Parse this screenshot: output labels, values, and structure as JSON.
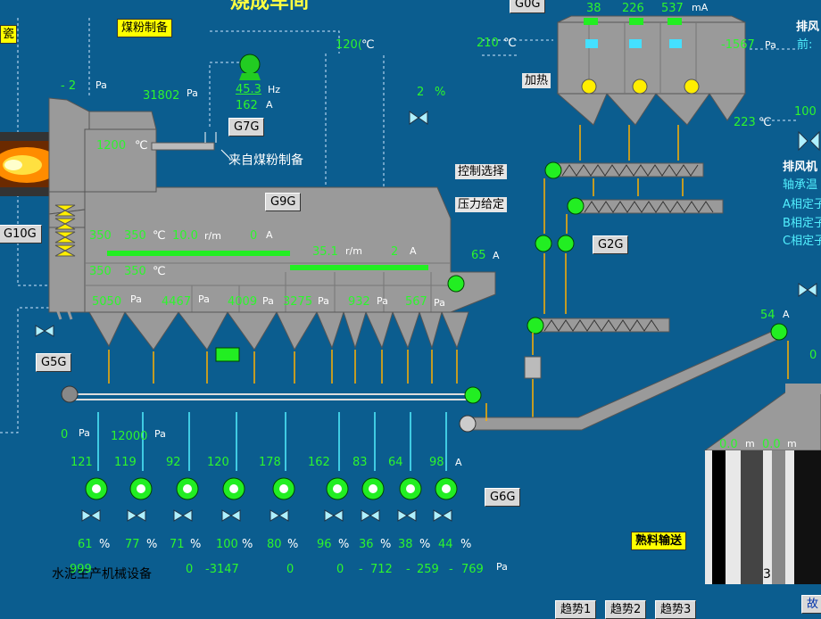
{
  "title": "烧成车间",
  "buttons": {
    "g0g": "G0G",
    "coal_prep": "煤粉制备",
    "g7g": "G7G",
    "g9g": "G9G",
    "g10g": "G10G",
    "g5g": "G5G",
    "g2g": "G2G",
    "g6g": "G6G",
    "heat": "加热",
    "control_select": "控制选择",
    "pressure_set": "压力给定",
    "clinker_transport": "熟料输送",
    "trend1": "趋势1",
    "trend2": "趋势2",
    "trend3": "趋势3",
    "fault": "故"
  },
  "labels": {
    "from_coal": "来自煤粉制备",
    "left_edge": "瓷",
    "footer_left": "水泥生产机械设备",
    "footer_page": "3"
  },
  "readings": {
    "pa_neg2": "-  2",
    "pa_unit": "Pa",
    "p_31802": "31802",
    "fan_hz": "45.3",
    "hz_unit": "Hz",
    "fan_a": "162",
    "a_unit": "A",
    "temp_120": "120(",
    "deg": "℃",
    "temp_210": "210",
    "temp_1200": "1200",
    "valve_pct": "2",
    "pct": "%",
    "dust_v1": "38",
    "dust_v2": "226",
    "dust_v3": "537",
    "ma_unit": "mA",
    "press_1567": "-1567",
    "temp_223": "223",
    "temp_100": "100",
    "cooler_350a": "350",
    "cooler_350b": "350",
    "cooler_10_0": "10.0",
    "rm_unit": "r/m",
    "cooler_0a": "0",
    "cooler_35_1": "35.1",
    "cooler_2a": "2",
    "cooler_350c": "350",
    "cooler_350d": "350",
    "motor_65": "65",
    "p_1": "5050",
    "p_2": "4467",
    "p_3": "4009",
    "p_4": "3275",
    "p_5": "932",
    "p_6": "567",
    "p_0": "0",
    "p_12000": "12000",
    "elev_54": "54",
    "silo_a": "0.0",
    "silo_b": "0.0",
    "m_unit": "m",
    "right_0": "0"
  },
  "fans": {
    "currents": [
      "121",
      "119",
      "92",
      "120",
      "178",
      "162",
      "83",
      "64",
      "98"
    ],
    "openings": [
      "61",
      "77",
      "71",
      "100",
      "80",
      "96",
      "36",
      "38",
      "44"
    ],
    "pressures": [
      "999",
      "0",
      "-3147",
      "0",
      "0",
      "-",
      "712",
      "-",
      "259",
      "-",
      "769"
    ]
  },
  "right_panel": {
    "exhaust_fan": "排风",
    "front": "前:",
    "exhaust_fan_full": "排风机",
    "bearing_temp": "轴承温",
    "phase_a": "A相定子",
    "phase_b": "B相定子",
    "phase_c": "C相定子"
  },
  "colors": {
    "background": "#0b5d8f",
    "equipment": "#9a9a9a",
    "running": "#22ee22",
    "arrow": "#ffb000"
  }
}
